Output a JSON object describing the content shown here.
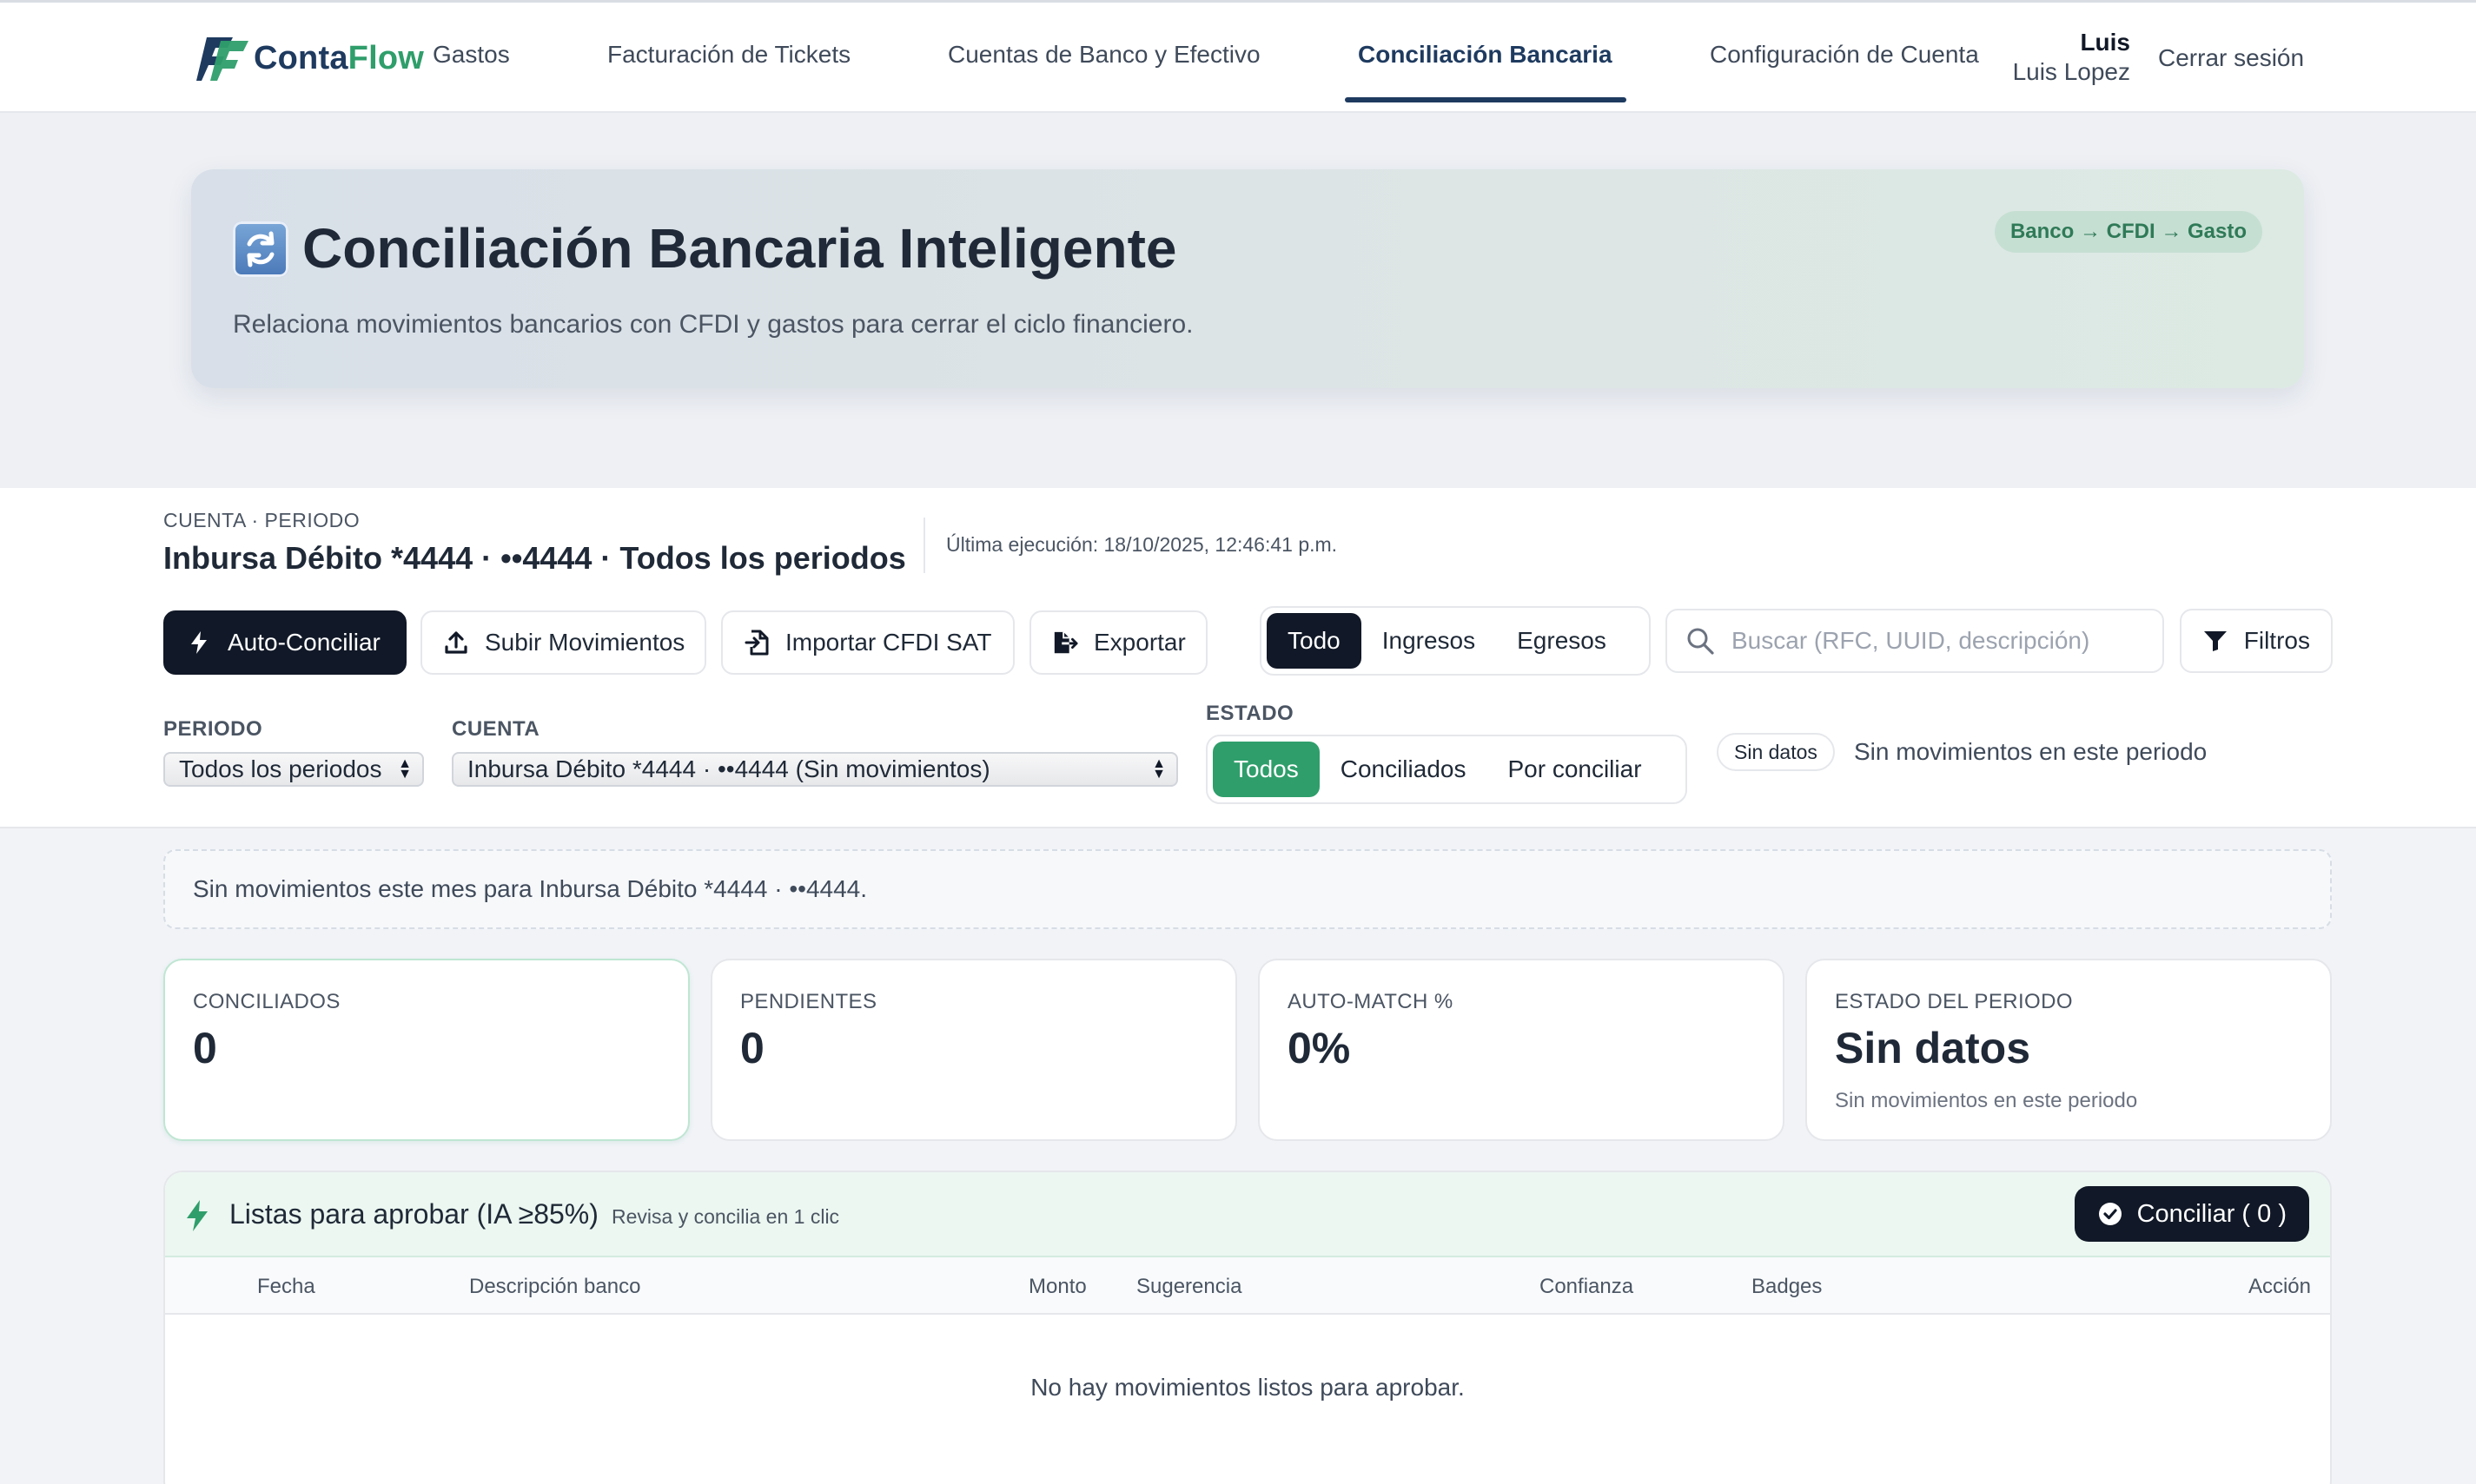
{
  "nav": {
    "logo": {
      "part1": "Conta",
      "part2": "Flow"
    },
    "items": [
      {
        "label": "Gastos"
      },
      {
        "label": "Facturación de Tickets"
      },
      {
        "label": "Cuentas de Banco y Efectivo"
      },
      {
        "label": "Conciliación Bancaria",
        "active": true
      },
      {
        "label": "Configuración de Cuenta"
      }
    ],
    "user": {
      "first_name": "Luis",
      "full_name": "Luis Lopez"
    },
    "logout": "Cerrar sesión"
  },
  "hero": {
    "icon": "refresh-icon",
    "title": "Conciliación Bancaria Inteligente",
    "subtitle": "Relaciona movimientos bancarios con CFDI y gastos para cerrar el ciclo financiero.",
    "badge": "Banco → CFDI → Gasto"
  },
  "account": {
    "label": "CUENTA · PERIODO",
    "title": "Inbursa Débito *4444 · ••4444 · Todos los periodos",
    "last_run": "Última ejecución: 18/10/2025, 12:46:41 p.m."
  },
  "toolbar": {
    "auto_conciliar": "Auto-Conciliar",
    "subir": "Subir Movimientos",
    "importar": "Importar CFDI SAT",
    "exportar": "Exportar",
    "type_filter": {
      "options": [
        "Todo",
        "Ingresos",
        "Egresos"
      ],
      "selected": "Todo"
    },
    "search_placeholder": "Buscar (RFC, UUID, descripción)",
    "filtros": "Filtros"
  },
  "filters": {
    "periodo_label": "PERIODO",
    "periodo_value": "Todos los periodos",
    "cuenta_label": "CUENTA",
    "cuenta_value": "Inbursa Débito *4444 · ••4444 (Sin movimientos)",
    "estado_label": "ESTADO",
    "estado": {
      "options": [
        "Todos",
        "Conciliados",
        "Por conciliar"
      ],
      "selected": "Todos"
    },
    "status_pill": "Sin datos",
    "status_text": "Sin movimientos en este periodo"
  },
  "notice": "Sin movimientos este mes para Inbursa Débito *4444 · ••4444.",
  "stats": [
    {
      "label": "CONCILIADOS",
      "value": "0"
    },
    {
      "label": "PENDIENTES",
      "value": "0"
    },
    {
      "label": "AUTO-MATCH %",
      "value": "0%"
    },
    {
      "label": "ESTADO DEL PERIODO",
      "value": "Sin datos",
      "sub": "Sin movimientos en este periodo"
    }
  ],
  "ready": {
    "title": "Listas para aprobar (IA ≥85%)",
    "subtitle": "Revisa y concilia en 1 clic",
    "button": "Conciliar ( 0 )",
    "columns": [
      "Fecha",
      "Descripción banco",
      "Monto",
      "Sugerencia",
      "Confianza",
      "Badges",
      "Acción"
    ],
    "empty": "No hay movimientos listos para aprobar."
  },
  "colors": {
    "brand_navy": "#1e3a5f",
    "brand_green": "#2f9e6b",
    "dark_button": "#111827"
  }
}
